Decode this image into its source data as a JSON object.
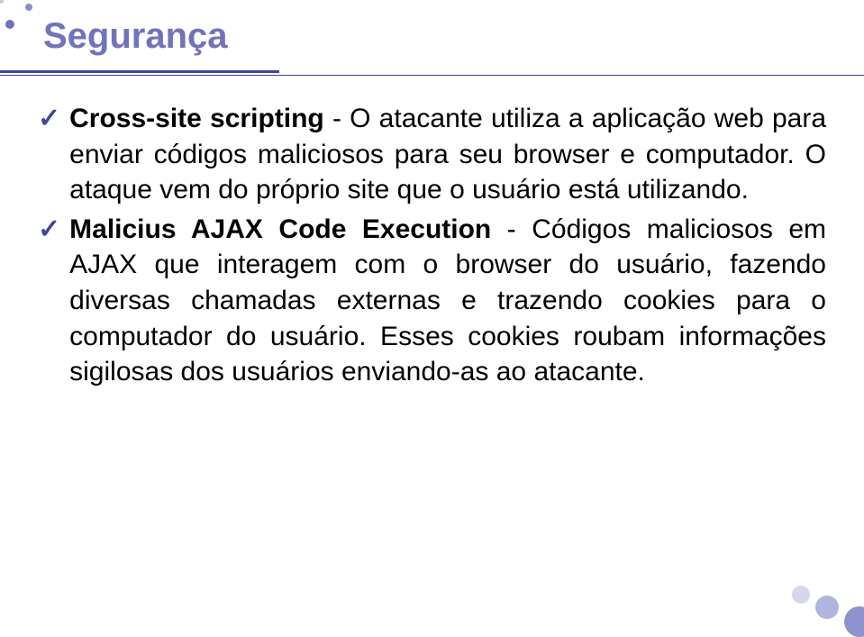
{
  "title": "Segurança",
  "bullets": [
    {
      "bold": "Cross-site scripting",
      "rest": " - O atacante utiliza a aplicação web para enviar códigos maliciosos para seu browser e computador. O ataque vem do próprio site que o usuário está utilizando."
    },
    {
      "bold": "Malicius AJAX Code Execution",
      "rest": " - Códigos maliciosos em AJAX que interagem com o browser do usuário, fazendo diversas chamadas externas e trazendo cookies para o computador do usuário. Esses cookies roubam informações sigilosas dos usuários enviando-as ao atacante."
    }
  ]
}
